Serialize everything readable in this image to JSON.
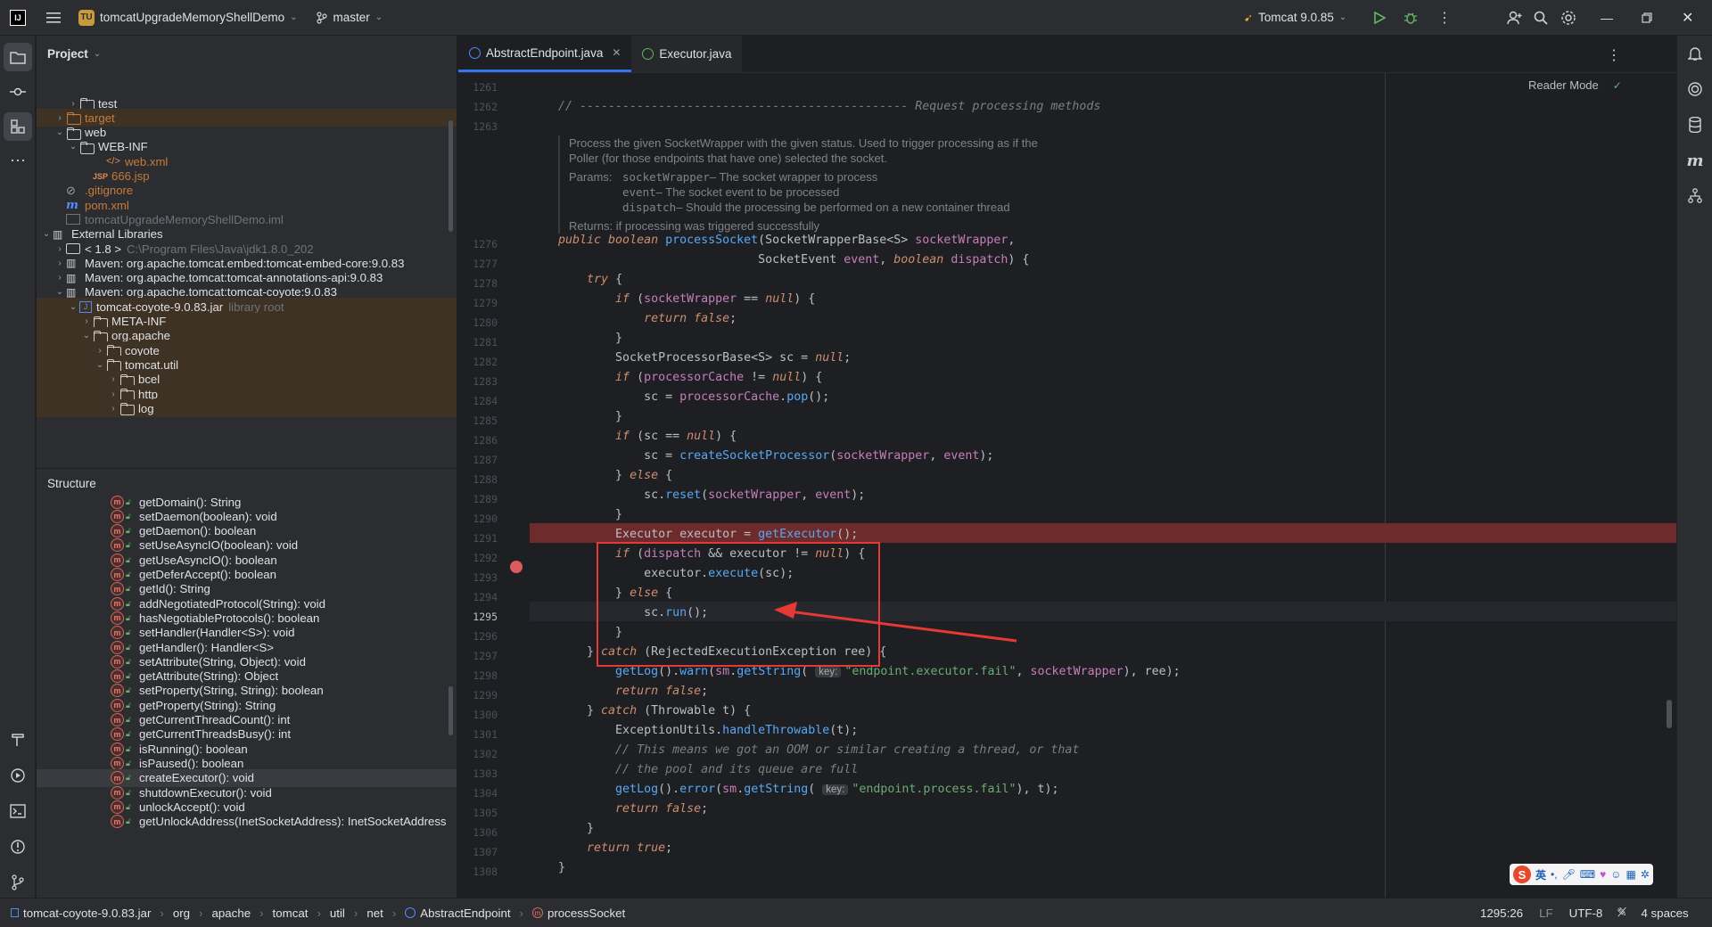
{
  "titlebar": {
    "app_icon": "IJ",
    "project_badge": "TU",
    "project_name": "tomcatUpgradeMemoryShellDemo",
    "branch": "master",
    "run_config": "Tomcat 9.0.85"
  },
  "project_panel": {
    "title": "Project",
    "rows": [
      {
        "label": "test",
        "type": "folder",
        "indent": 2,
        "arrow": "›",
        "hl": false
      },
      {
        "label": "target",
        "type": "folder-orange",
        "indent": 1,
        "arrow": "›",
        "hl": true
      },
      {
        "label": "web",
        "type": "folder",
        "indent": 1,
        "arrow": "⌄",
        "hl": false
      },
      {
        "label": "WEB-INF",
        "type": "folder",
        "indent": 2,
        "arrow": "⌄",
        "hl": false
      },
      {
        "label": "web.xml",
        "type": "xml",
        "indent": 4,
        "arrow": "",
        "hl": false
      },
      {
        "label": "666.jsp",
        "type": "jsp",
        "indent": 3,
        "arrow": "",
        "hl": false
      },
      {
        "label": ".gitignore",
        "type": "git",
        "indent": 1,
        "arrow": "",
        "hl": false
      },
      {
        "label": "pom.xml",
        "type": "maven",
        "indent": 1,
        "arrow": "",
        "hl": false
      },
      {
        "label": "tomcatUpgradeMemoryShellDemo.iml",
        "type": "iml",
        "indent": 1,
        "arrow": "",
        "hl": false
      },
      {
        "label": "External Libraries",
        "type": "lib",
        "indent": 0,
        "arrow": "⌄",
        "hl": false
      },
      {
        "label": "< 1.8 >",
        "extra": "C:\\Program Files\\Java\\jdk1.8.0_202",
        "type": "jdk",
        "indent": 1,
        "arrow": "›",
        "hl": false
      },
      {
        "label": "Maven: org.apache.tomcat.embed:tomcat-embed-core:9.0.83",
        "type": "lib",
        "indent": 1,
        "arrow": "›",
        "hl": false
      },
      {
        "label": "Maven: org.apache.tomcat:tomcat-annotations-api:9.0.83",
        "type": "lib",
        "indent": 1,
        "arrow": "›",
        "hl": false
      },
      {
        "label": "Maven: org.apache.tomcat:tomcat-coyote:9.0.83",
        "type": "lib",
        "indent": 1,
        "arrow": "⌄",
        "hl": false
      },
      {
        "label": "tomcat-coyote-9.0.83.jar",
        "extra": "library root",
        "type": "jar",
        "indent": 2,
        "arrow": "⌄",
        "hl": true
      },
      {
        "label": "META-INF",
        "type": "folder",
        "indent": 3,
        "arrow": "›",
        "hl": true
      },
      {
        "label": "org.apache",
        "type": "folder",
        "indent": 3,
        "arrow": "⌄",
        "hl": true
      },
      {
        "label": "coyote",
        "type": "folder",
        "indent": 4,
        "arrow": "›",
        "hl": true
      },
      {
        "label": "tomcat.util",
        "type": "folder",
        "indent": 4,
        "arrow": "⌄",
        "hl": true
      },
      {
        "label": "bcel",
        "type": "folder",
        "indent": 5,
        "arrow": "›",
        "hl": true
      },
      {
        "label": "http",
        "type": "folder",
        "indent": 5,
        "arrow": "›",
        "hl": true
      },
      {
        "label": "log",
        "type": "folder",
        "indent": 5,
        "arrow": "›",
        "hl": true
      }
    ]
  },
  "structure_panel": {
    "title": "Structure",
    "rows": [
      {
        "label": "getDomain(): String",
        "sel": false
      },
      {
        "label": "setDaemon(boolean): void",
        "sel": false
      },
      {
        "label": "getDaemon(): boolean",
        "sel": false
      },
      {
        "label": "setUseAsyncIO(boolean): void",
        "sel": false
      },
      {
        "label": "getUseAsyncIO(): boolean",
        "sel": false
      },
      {
        "label": "getDeferAccept(): boolean",
        "sel": false
      },
      {
        "label": "getId(): String",
        "sel": false
      },
      {
        "label": "addNegotiatedProtocol(String): void",
        "sel": false
      },
      {
        "label": "hasNegotiableProtocols(): boolean",
        "sel": false
      },
      {
        "label": "setHandler(Handler<S>): void",
        "sel": false
      },
      {
        "label": "getHandler(): Handler<S>",
        "sel": false
      },
      {
        "label": "setAttribute(String, Object): void",
        "sel": false
      },
      {
        "label": "getAttribute(String): Object",
        "sel": false
      },
      {
        "label": "setProperty(String, String): boolean",
        "sel": false
      },
      {
        "label": "getProperty(String): String",
        "sel": false
      },
      {
        "label": "getCurrentThreadCount(): int",
        "sel": false
      },
      {
        "label": "getCurrentThreadsBusy(): int",
        "sel": false
      },
      {
        "label": "isRunning(): boolean",
        "sel": false
      },
      {
        "label": "isPaused(): boolean",
        "sel": false
      },
      {
        "label": "createExecutor(): void",
        "sel": true
      },
      {
        "label": "shutdownExecutor(): void",
        "sel": false
      },
      {
        "label": "unlockAccept(): void",
        "sel": false
      },
      {
        "label": "getUnlockAddress(InetSocketAddress): InetSocketAddress",
        "sel": false
      }
    ]
  },
  "editor": {
    "tabs": [
      {
        "label": "AbstractEndpoint.java",
        "active": true,
        "closable": true
      },
      {
        "label": "Executor.java",
        "active": false,
        "closable": false
      }
    ],
    "reader_mode": "Reader Mode",
    "doc": {
      "summary1": "Process the given SocketWrapper with the given status. Used to trigger processing as if the",
      "summary2": "Poller (for those endpoints that have one) selected the socket.",
      "params_label": "Params:",
      "p1": "socketWrapper",
      "p1d": " – The socket wrapper to process",
      "p2": "event",
      "p2d": " – The socket event to be processed",
      "p3": "dispatch",
      "p3d": " – Should the processing be performed on a new container thread",
      "returns": "Returns: if processing was triggered successfully"
    },
    "line_numbers": [
      "1261",
      "1262",
      "1263",
      "1276",
      "1277",
      "1278",
      "1279",
      "1280",
      "1281",
      "1282",
      "1283",
      "1284",
      "1285",
      "1286",
      "1287",
      "1288",
      "1289",
      "1290",
      "1291",
      "1292",
      "1293",
      "1294",
      "1295",
      "1296",
      "1297",
      "1298",
      "1299",
      "1300",
      "1301",
      "1302",
      "1303",
      "1304",
      "1305",
      "1306",
      "1307",
      "1308"
    ],
    "hint_key": "key:",
    "str_fail": "\"endpoint.executor.fail\"",
    "str_process": "\"endpoint.process.fail\"",
    "comment_section": "// ---------------------------------------------- Request processing methods",
    "comment1": "// This means we got an OOM or similar creating a thread, or that",
    "comment2": "// the pool and its queue are full"
  },
  "statusbar": {
    "crumbs": [
      "tomcat-coyote-9.0.83.jar",
      "org",
      "apache",
      "tomcat",
      "util",
      "net",
      "AbstractEndpoint",
      "processSocket"
    ],
    "position": "1295:26",
    "line_sep": "LF",
    "encoding": "UTF-8",
    "indent": "4 spaces"
  },
  "ime": {
    "label": "英"
  },
  "colors": {
    "accent": "#3574f0",
    "breakpoint_line": "#6e2b2b",
    "annotation_red": "#e53935"
  }
}
